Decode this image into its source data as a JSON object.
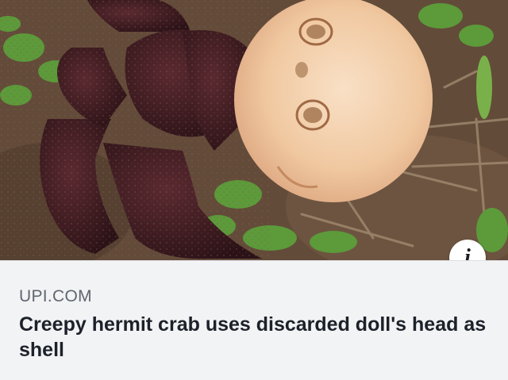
{
  "link_preview": {
    "image_alt": "Hermit crab wearing a discarded doll's head as a shell",
    "domain": "UPI.COM",
    "headline": "Creepy hermit crab uses discarded doll's head as shell",
    "info_icon_glyph": "i"
  },
  "icons": {
    "info": "info-icon"
  },
  "colors": {
    "card_background": "#f2f3f5",
    "domain_text": "#606770",
    "headline_text": "#1d2129"
  }
}
